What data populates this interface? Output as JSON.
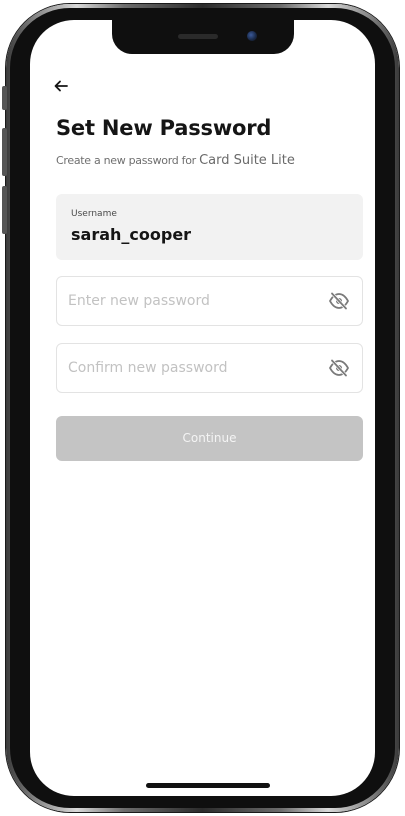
{
  "header": {
    "back_icon": "arrow-left-icon"
  },
  "title": "Set New Password",
  "subtitle": {
    "prefix": "Create a new password for ",
    "app_name": "Card Suite Lite"
  },
  "username": {
    "label": "Username",
    "value": "sarah_cooper"
  },
  "new_password": {
    "placeholder": "Enter new password",
    "value": "",
    "toggle_icon": "eye-off-icon"
  },
  "confirm_password": {
    "placeholder": "Confirm new password",
    "value": "",
    "toggle_icon": "eye-off-icon"
  },
  "continue_label": "Continue",
  "colors": {
    "button_disabled": "#c4c4c4",
    "username_bg": "#f2f2f2",
    "title_text": "#151515"
  }
}
